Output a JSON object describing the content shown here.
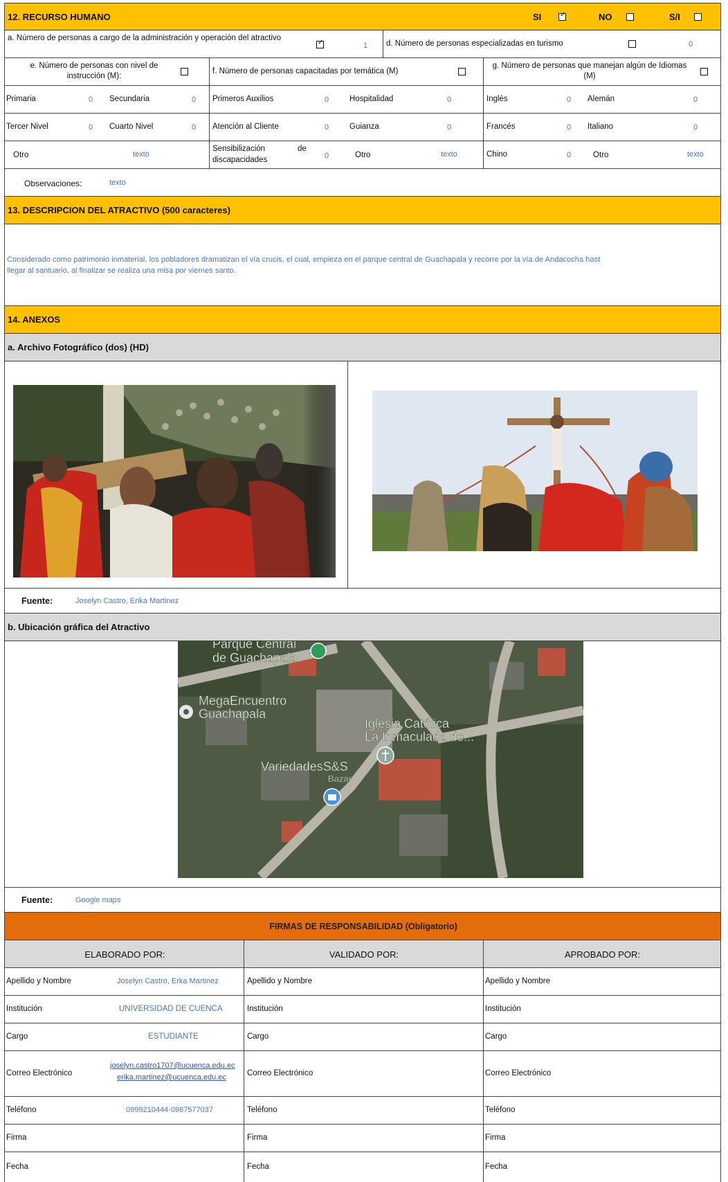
{
  "section12": {
    "title": "12. RECURSO HUMANO",
    "si_label": "SI",
    "no_label": "NO",
    "si_label2": "S/I",
    "a_label": "a. Número de personas a cargo de la administración y operación del atractivo",
    "a_value": "1",
    "d_label": "d. Número de personas especializadas en turismo",
    "d_value": "0",
    "e_label": "e. Número de personas con nivel de instrucción (M):",
    "f_label": "f. Número de personas capacitadas por temática (M)",
    "g_label": "g. Número de personas que manejan algún de Idiomas (M)",
    "rows": [
      {
        "c1": "Primaria",
        "v1": "0",
        "c2": "Secundaria",
        "v2": "0",
        "c3": "Primeros Auxilios",
        "v3": "0",
        "c4": "Hospitalidad",
        "v4": "0",
        "c5": "Inglés",
        "v5": "0",
        "c6": "Alemán",
        "v6": "0"
      },
      {
        "c1": "Tercer Nivel",
        "v1": "0",
        "c2": "Cuarto Nivel",
        "v2": "0",
        "c3": "Atención al Cliente",
        "v3": "0",
        "c4": "Guianza",
        "v4": "0",
        "c5": "Francés",
        "v5": "0",
        "c6": "Italiano",
        "v6": "0"
      },
      {
        "c1": "Otro",
        "v1": "texto",
        "c3a": "Sensibilización",
        "c3b": "de",
        "c3c": "discapacidades",
        "v3": "0",
        "c4": "Otro",
        "v4": "texto",
        "c5": "Chino",
        "v5": "0",
        "c6": "Otro",
        "v6": "texto"
      }
    ],
    "obs_label": "Observaciones:",
    "obs_value": "texto"
  },
  "section13": {
    "title": "13. DESCRIPCION DEL ATRACTIVO (500 caracteres)",
    "line1": "Considerado como patrimonio inmaterial, los pobladores dramatizan el vía crucis, el cual, empieza en el parque central de Guachapala y recorre por la vía de Andacocha hast",
    "line2": "llegar al santuario, al finalizar se realiza una misa por viernes santo."
  },
  "section14": {
    "title": "14. ANEXOS",
    "photo_title": "a. Archivo Fotográfico (dos) (HD)",
    "fuente_label": "Fuente:",
    "fuente_photo": "Joselyn Castro, Erika Martinez",
    "map_title": "b. Ubicación gráfica del Atractivo",
    "map_labels": {
      "parque1": "Parque Central",
      "parque2": "de Guachapala",
      "mega1": "MegaEncuentro",
      "mega2": "Guachapala",
      "iglesia1": "Iglesia Católica",
      "iglesia2": "La Inmaculada de...",
      "variedades": "VariedadesS&S",
      "bazar": "Bazar"
    },
    "fuente_map": "Google maps"
  },
  "firmas": {
    "title": "FIRMAS DE RESPONSABILIDAD (Obligatorio)",
    "cols": [
      "ELABORADO POR:",
      "VALIDADO  POR:",
      "APROBADO POR:"
    ],
    "labels": [
      "Apellido y Nombre",
      "Institución",
      "Cargo",
      "Correo Electrónico",
      "Teléfono",
      "Firma",
      "Fecha"
    ],
    "nombre": "Joselyn Castro, Erka Martinez",
    "institucion": "UNIVERSIDAD DE CUENCA",
    "cargo": "ESTUDIANTE",
    "correo1": "joselyn.castro1707@ucuenca.edu.ec",
    "correo2": "erika.martinez@ucuenca.edu.ec",
    "telefono": "0999210444-0987577037"
  },
  "colors": {
    "yellow": "#ffc000",
    "orange": "#e46c0a",
    "grey": "#d9d9d9",
    "blue_text": "#4a76c2"
  }
}
